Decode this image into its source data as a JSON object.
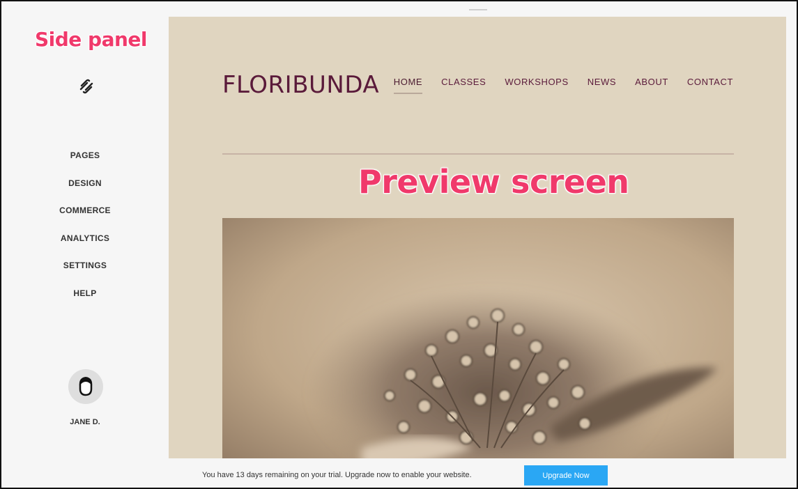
{
  "annotations": {
    "side_panel": "Side panel",
    "preview_screen": "Preview screen"
  },
  "sidebar": {
    "logo_icon": "squarespace-logo-icon",
    "items": [
      {
        "label": "PAGES"
      },
      {
        "label": "DESIGN"
      },
      {
        "label": "COMMERCE"
      },
      {
        "label": "ANALYTICS"
      },
      {
        "label": "SETTINGS"
      },
      {
        "label": "HELP"
      }
    ],
    "user": {
      "avatar_icon": "user-avatar-icon",
      "name": "JANE D."
    }
  },
  "preview": {
    "site_title": "FLORIBUNDA",
    "nav": [
      {
        "label": "HOME",
        "active": true
      },
      {
        "label": "CLASSES"
      },
      {
        "label": "WORKSHOPS"
      },
      {
        "label": "NEWS"
      },
      {
        "label": "ABOUT"
      },
      {
        "label": "CONTACT"
      }
    ],
    "colors": {
      "background": "#e0d5c0",
      "title": "#5a1a3a",
      "divider": "#c7b3a6"
    }
  },
  "trial_bar": {
    "message": "You have 13 days remaining on your trial. Upgrade now to enable your website.",
    "button_label": "Upgrade Now",
    "button_color": "#2aa7f4"
  }
}
